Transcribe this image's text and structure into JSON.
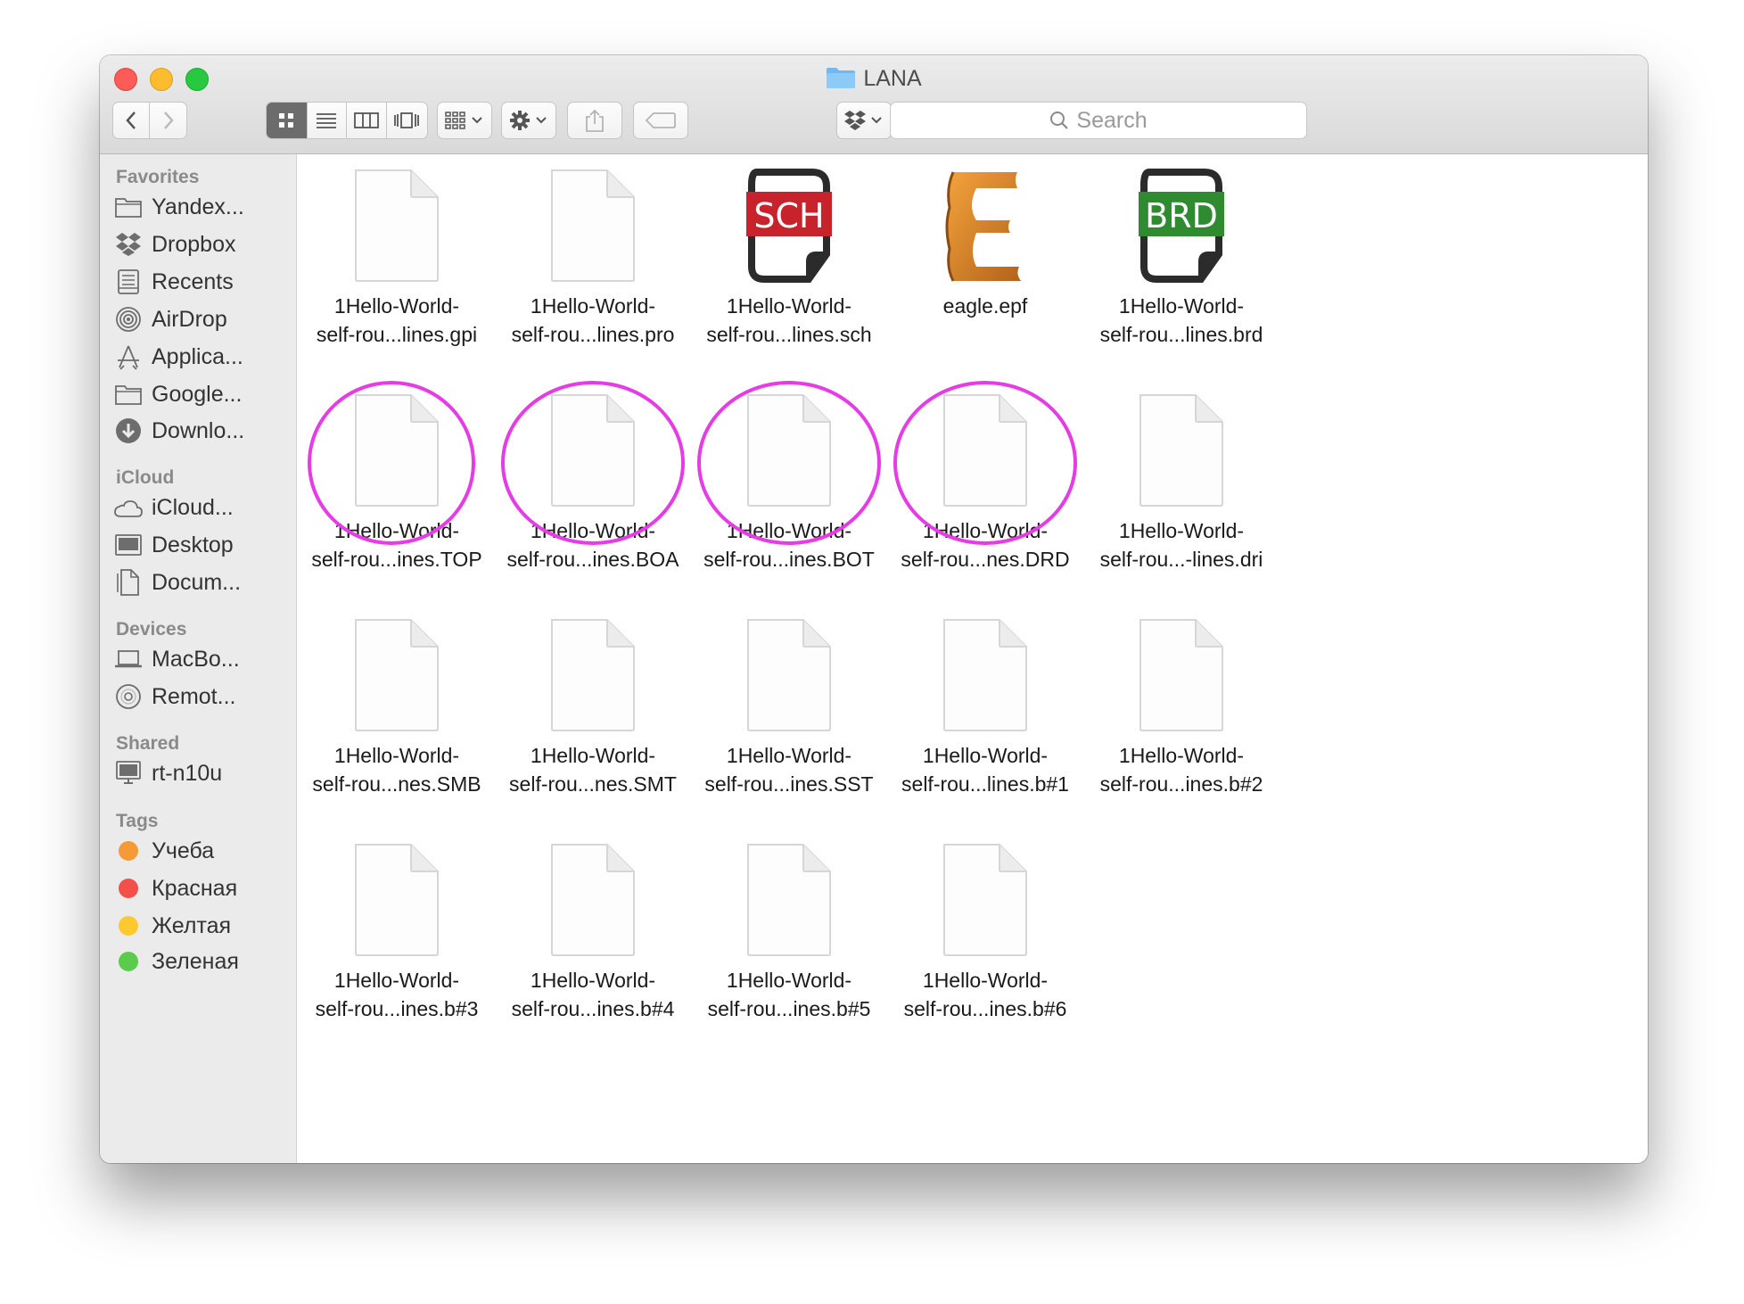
{
  "window": {
    "title": "LANA",
    "colors": {
      "annotation_circle": "#e53ce5",
      "sidebar_bg": "#ebebeb"
    }
  },
  "toolbar": {
    "back_icon": "chevron-left-icon",
    "forward_icon": "chevron-right-icon",
    "view_modes": [
      "icon-view",
      "list-view",
      "column-view",
      "cover-flow-view"
    ],
    "active_view": "icon-view",
    "search_placeholder": "Search"
  },
  "sidebar": {
    "favorites_label": "Favorites",
    "favorites": [
      {
        "label": "Yandex...",
        "icon": "folder-icon"
      },
      {
        "label": "Dropbox",
        "icon": "dropbox-icon"
      },
      {
        "label": "Recents",
        "icon": "recents-icon"
      },
      {
        "label": "AirDrop",
        "icon": "airdrop-icon"
      },
      {
        "label": "Applica...",
        "icon": "applications-icon"
      },
      {
        "label": "Google...",
        "icon": "folder-icon"
      },
      {
        "label": "Downlo...",
        "icon": "downloads-icon"
      }
    ],
    "icloud_label": "iCloud",
    "icloud": [
      {
        "label": "iCloud...",
        "icon": "cloud-icon"
      },
      {
        "label": "Desktop",
        "icon": "desktop-icon"
      },
      {
        "label": "Docum...",
        "icon": "documents-icon"
      }
    ],
    "devices_label": "Devices",
    "devices": [
      {
        "label": "MacBo...",
        "icon": "laptop-icon"
      },
      {
        "label": "Remot...",
        "icon": "disc-icon"
      }
    ],
    "shared_label": "Shared",
    "shared": [
      {
        "label": "rt-n10u",
        "icon": "monitor-icon"
      }
    ],
    "tags_label": "Tags",
    "tags": [
      {
        "label": "Учеба",
        "color": "#f59a36"
      },
      {
        "label": "Красная",
        "color": "#f4504a"
      },
      {
        "label": "Желтая",
        "color": "#fdc92f"
      },
      {
        "label": "Зеленая",
        "color": "#5bcb4b"
      }
    ]
  },
  "files": [
    {
      "label": "1Hello-World-\nself-rou...lines.gpi",
      "icon": "blank-document-icon"
    },
    {
      "label": "1Hello-World-\nself-rou...lines.pro",
      "icon": "blank-document-icon"
    },
    {
      "label": "1Hello-World-\nself-rou...lines.sch",
      "icon": "sch-file-icon",
      "badge": "SCH",
      "badge_color": "#c8232c"
    },
    {
      "label": "eagle.epf",
      "icon": "eagle-app-icon",
      "badge": "E",
      "badge_color": "#e08a25"
    },
    {
      "label": "1Hello-World-\nself-rou...lines.brd",
      "icon": "brd-file-icon",
      "badge": "BRD",
      "badge_color": "#2e8b2f"
    },
    {
      "label": "1Hello-World-\nself-rou...ines.TOP",
      "icon": "blank-document-icon",
      "circled": true
    },
    {
      "label": "1Hello-World-\nself-rou...ines.BOA",
      "icon": "blank-document-icon",
      "circled": true
    },
    {
      "label": "1Hello-World-\nself-rou...ines.BOT",
      "icon": "blank-document-icon",
      "circled": true
    },
    {
      "label": "1Hello-World-\nself-rou...nes.DRD",
      "icon": "blank-document-icon",
      "circled": true
    },
    {
      "label": "1Hello-World-\nself-rou...-lines.dri",
      "icon": "blank-document-icon"
    },
    {
      "label": "1Hello-World-\nself-rou...nes.SMB",
      "icon": "blank-document-icon"
    },
    {
      "label": "1Hello-World-\nself-rou...nes.SMT",
      "icon": "blank-document-icon"
    },
    {
      "label": "1Hello-World-\nself-rou...ines.SST",
      "icon": "blank-document-icon"
    },
    {
      "label": "1Hello-World-\nself-rou...lines.b#1",
      "icon": "blank-document-icon"
    },
    {
      "label": "1Hello-World-\nself-rou...ines.b#2",
      "icon": "blank-document-icon"
    },
    {
      "label": "1Hello-World-\nself-rou...ines.b#3",
      "icon": "blank-document-icon"
    },
    {
      "label": "1Hello-World-\nself-rou...ines.b#4",
      "icon": "blank-document-icon"
    },
    {
      "label": "1Hello-World-\nself-rou...ines.b#5",
      "icon": "blank-document-icon"
    },
    {
      "label": "1Hello-World-\nself-rou...ines.b#6",
      "icon": "blank-document-icon"
    }
  ]
}
